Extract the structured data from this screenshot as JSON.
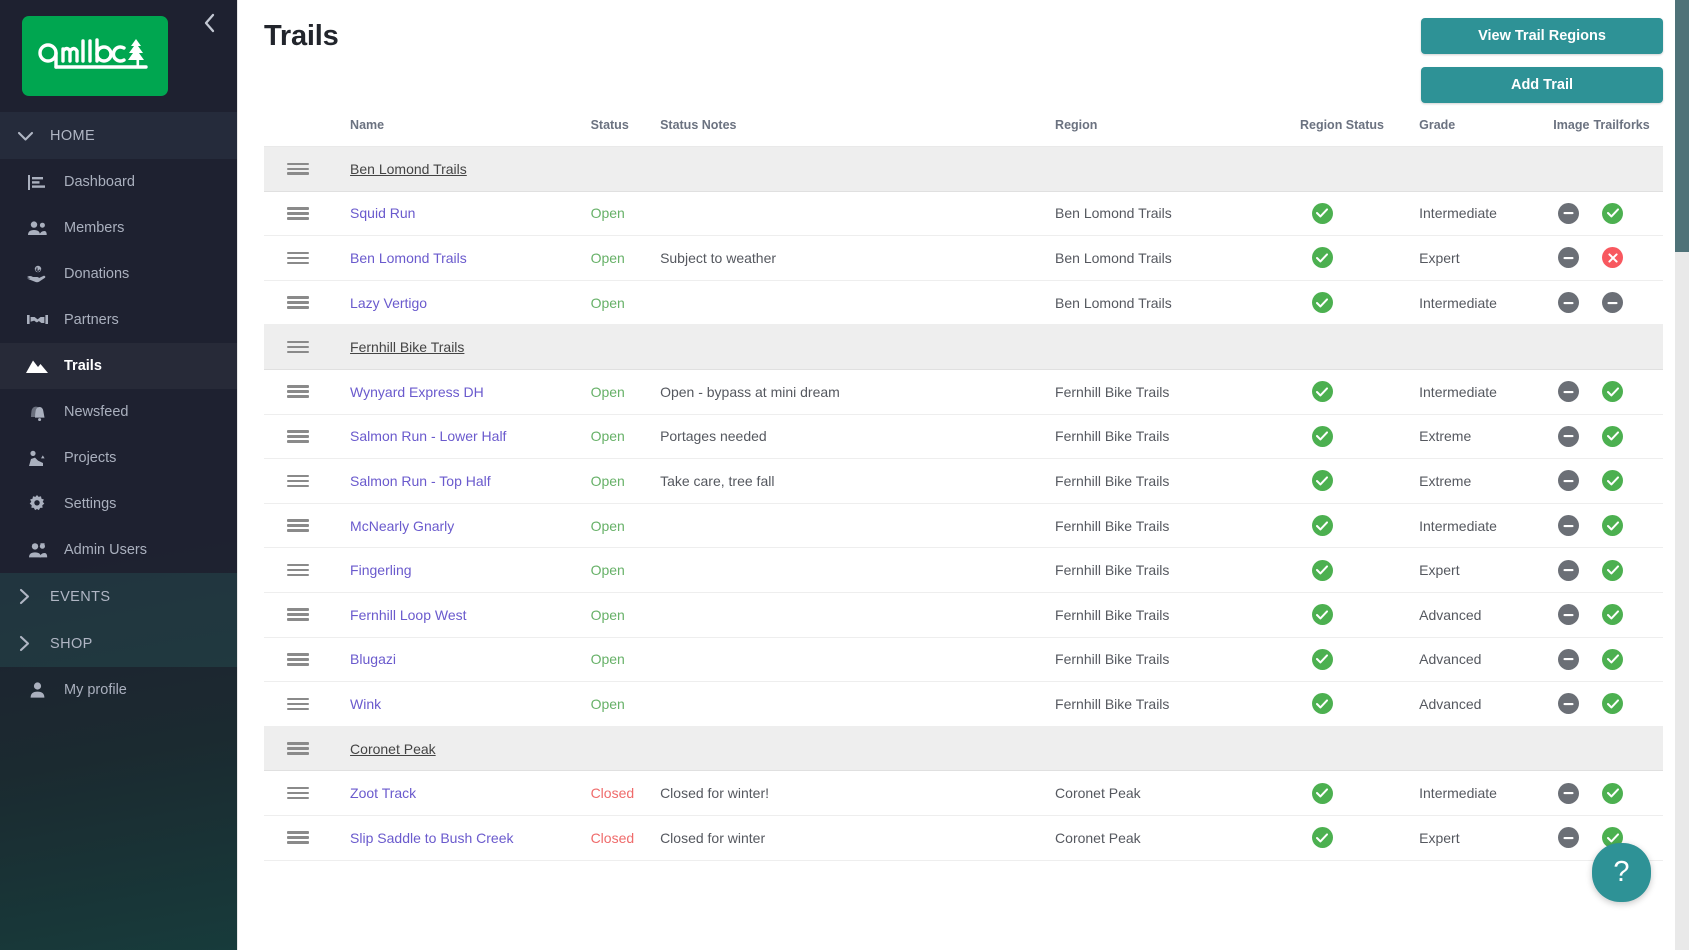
{
  "sidebar": {
    "logo_text": "qmtbc",
    "collapse_icon": "chevron-left-icon",
    "sections": [
      {
        "label": "HOME",
        "icon": "chevron-down-icon",
        "expanded": true
      },
      {
        "label": "EVENTS",
        "icon": "chevron-right-icon",
        "expanded": false
      },
      {
        "label": "SHOP",
        "icon": "chevron-right-icon",
        "expanded": false
      }
    ],
    "items": [
      {
        "label": "Dashboard",
        "icon": "chart-bar-icon",
        "active": false
      },
      {
        "label": "Members",
        "icon": "users-icon",
        "active": false
      },
      {
        "label": "Donations",
        "icon": "hand-coin-icon",
        "active": false
      },
      {
        "label": "Partners",
        "icon": "handshake-icon",
        "active": false
      },
      {
        "label": "Trails",
        "icon": "mountain-icon",
        "active": true
      },
      {
        "label": "Newsfeed",
        "icon": "bell-icon",
        "active": false
      },
      {
        "label": "Projects",
        "icon": "worker-icon",
        "active": false
      },
      {
        "label": "Settings",
        "icon": "gear-icon",
        "active": false
      },
      {
        "label": "Admin Users",
        "icon": "user-cog-icon",
        "active": false
      }
    ],
    "profile": {
      "label": "My profile",
      "icon": "user-icon"
    }
  },
  "header": {
    "title": "Trails",
    "view_regions_label": "View Trail Regions",
    "add_trail_label": "Add Trail",
    "accent_color": "#2e9296"
  },
  "table": {
    "columns": [
      {
        "key": "handle",
        "label": ""
      },
      {
        "key": "name",
        "label": "Name"
      },
      {
        "key": "status",
        "label": "Status"
      },
      {
        "key": "notes",
        "label": "Status Notes"
      },
      {
        "key": "region",
        "label": "Region"
      },
      {
        "key": "region_status",
        "label": "Region Status"
      },
      {
        "key": "grade",
        "label": "Grade"
      },
      {
        "key": "image",
        "label": "Image"
      },
      {
        "key": "trailforks",
        "label": "Trailforks"
      }
    ],
    "rows": [
      {
        "type": "group",
        "name": "Ben Lomond Trails"
      },
      {
        "type": "trail",
        "name": "Squid Run",
        "status": "Open",
        "notes": "",
        "region": "Ben Lomond Trails",
        "region_status": "ok",
        "grade": "Intermediate",
        "image": "dash",
        "trailforks": "ok"
      },
      {
        "type": "trail",
        "name": "Ben Lomond Trails",
        "status": "Open",
        "notes": "Subject to weather",
        "region": "Ben Lomond Trails",
        "region_status": "ok",
        "grade": "Expert",
        "image": "dash",
        "trailforks": "no"
      },
      {
        "type": "trail",
        "name": "Lazy Vertigo",
        "status": "Open",
        "notes": "",
        "region": "Ben Lomond Trails",
        "region_status": "ok",
        "grade": "Intermediate",
        "image": "dash",
        "trailforks": "dash"
      },
      {
        "type": "group",
        "name": "Fernhill Bike Trails"
      },
      {
        "type": "trail",
        "name": "Wynyard Express DH",
        "status": "Open",
        "notes": "Open - bypass at mini dream",
        "region": "Fernhill Bike Trails",
        "region_status": "ok",
        "grade": "Intermediate",
        "image": "dash",
        "trailforks": "ok"
      },
      {
        "type": "trail",
        "name": "Salmon Run - Lower Half",
        "status": "Open",
        "notes": "Portages needed",
        "region": "Fernhill Bike Trails",
        "region_status": "ok",
        "grade": "Extreme",
        "image": "dash",
        "trailforks": "ok"
      },
      {
        "type": "trail",
        "name": "Salmon Run - Top Half",
        "status": "Open",
        "notes": "Take care, tree fall",
        "region": "Fernhill Bike Trails",
        "region_status": "ok",
        "grade": "Extreme",
        "image": "dash",
        "trailforks": "ok"
      },
      {
        "type": "trail",
        "name": "McNearly Gnarly",
        "status": "Open",
        "notes": "",
        "region": "Fernhill Bike Trails",
        "region_status": "ok",
        "grade": "Intermediate",
        "image": "dash",
        "trailforks": "ok"
      },
      {
        "type": "trail",
        "name": "Fingerling",
        "status": "Open",
        "notes": "",
        "region": "Fernhill Bike Trails",
        "region_status": "ok",
        "grade": "Expert",
        "image": "dash",
        "trailforks": "ok"
      },
      {
        "type": "trail",
        "name": "Fernhill Loop West",
        "status": "Open",
        "notes": "",
        "region": "Fernhill Bike Trails",
        "region_status": "ok",
        "grade": "Advanced",
        "image": "dash",
        "trailforks": "ok"
      },
      {
        "type": "trail",
        "name": "Blugazi",
        "status": "Open",
        "notes": "",
        "region": "Fernhill Bike Trails",
        "region_status": "ok",
        "grade": "Advanced",
        "image": "dash",
        "trailforks": "ok"
      },
      {
        "type": "trail",
        "name": "Wink",
        "status": "Open",
        "notes": "",
        "region": "Fernhill Bike Trails",
        "region_status": "ok",
        "grade": "Advanced",
        "image": "dash",
        "trailforks": "ok"
      },
      {
        "type": "group",
        "name": "Coronet Peak"
      },
      {
        "type": "trail",
        "name": "Zoot Track",
        "status": "Closed",
        "notes": "Closed for winter!",
        "region": "Coronet Peak",
        "region_status": "ok",
        "grade": "Intermediate",
        "image": "dash",
        "trailforks": "ok"
      },
      {
        "type": "trail",
        "name": "Slip Saddle to Bush Creek",
        "status": "Closed",
        "notes": "Closed for winter",
        "region": "Coronet Peak",
        "region_status": "ok",
        "grade": "Expert",
        "image": "dash",
        "trailforks": "ok"
      }
    ]
  },
  "help": {
    "label": "?",
    "icon": "question-mark-icon"
  },
  "colors": {
    "accent": "#2e9296",
    "brand_green": "#00a650",
    "status_open": "#67b168",
    "status_closed": "#ef6b6b",
    "badge_ok": "#4cb050",
    "badge_no": "#f8585f",
    "badge_dash": "#6b6f76",
    "link": "#6a5acd",
    "sidebar_bg": "#1e2130"
  }
}
